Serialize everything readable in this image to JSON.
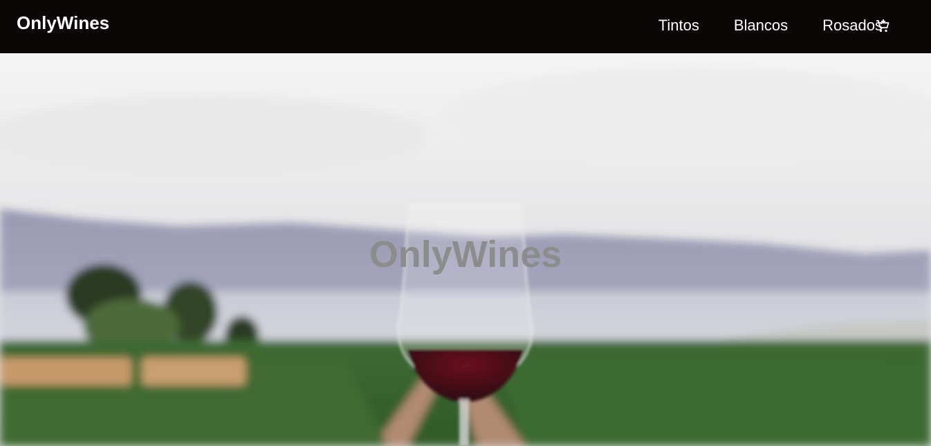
{
  "nav": {
    "brand": "OnlyWines",
    "links": [
      {
        "label": "Tintos"
      },
      {
        "label": "Blancos"
      },
      {
        "label": "Rosados"
      }
    ],
    "cart_icon": "add-shopping-cart-icon"
  },
  "hero": {
    "title": "OnlyWines",
    "image": "vineyard-wine-glass-photo"
  },
  "colors": {
    "nav_bg": "#0b0707",
    "nav_text": "#ffffff",
    "hero_title": "#8c8c8c"
  }
}
